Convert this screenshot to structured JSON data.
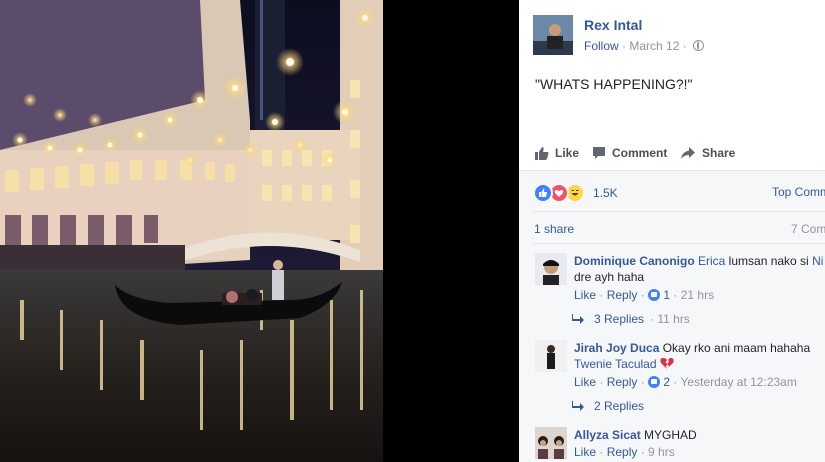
{
  "post": {
    "author": "Rex Intal",
    "follow_label": "Follow",
    "date": "March 12",
    "text": "\"WHATS HAPPENING?!\""
  },
  "actions": {
    "like": "Like",
    "comment": "Comment",
    "share": "Share"
  },
  "reactions": {
    "count": "1.5K",
    "types": [
      "like",
      "love",
      "haha"
    ],
    "top_comments_label": "Top Comm"
  },
  "shares": "1 share",
  "comments_count": "7 Com",
  "comments": [
    {
      "name": "Dominique Canonigo",
      "tag": "Erica",
      "text_line1": " lumsan nako si",
      "tag2": "Ni",
      "text_line2": "dre ayh haha",
      "like_label": "Like",
      "reply_label": "Reply",
      "likes": "1",
      "age": "21 hrs",
      "replies_label": "3 Replies",
      "replies_age": "11 hrs"
    },
    {
      "name": "Jirah Joy Duca",
      "text_line1": " Okay rko ani maam hahaha",
      "tag": "Twenie Taculad",
      "like_label": "Like",
      "reply_label": "Reply",
      "likes": "2",
      "age": "Yesterday at 12:23am",
      "replies_label": "2 Replies"
    },
    {
      "name": "Allyza Sicat",
      "text_line1": " MYGHAD",
      "like_label": "Like",
      "reply_label": "Reply",
      "age": "9 hrs"
    }
  ],
  "colors": {
    "link": "#365899",
    "like_blue": "#4080ff",
    "love_red": "#f25268",
    "haha_yellow": "#fcd845"
  }
}
